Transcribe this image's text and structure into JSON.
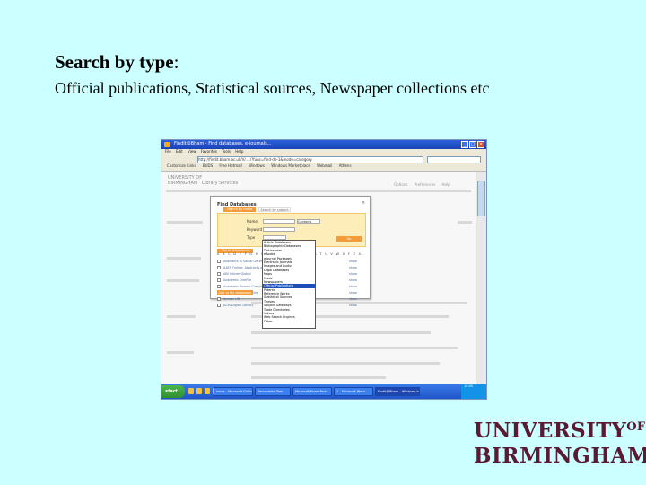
{
  "heading": {
    "bold": "Search by type",
    "rest": ":"
  },
  "subheading": "Official publications, Statistical sources, Newspaper collections etc",
  "browser": {
    "title": "FindIt@Bham - Find databases, e-journals...",
    "menu": [
      "File",
      "Edit",
      "View",
      "Favorites",
      "Tools",
      "Help"
    ],
    "address": "http://findit.bham.ac.uk/V/..../?func=find-db-1&mode=category",
    "links": [
      "Customize Links",
      "BUDS",
      "Free Hotmail",
      "Windows",
      "Windows Marketplace",
      "Webmail",
      "Athens"
    ]
  },
  "page": {
    "logo": "UNIVERSITY OF\nBIRMINGHAM   Library Services",
    "toplinks": [
      "Options",
      "Preferences",
      "Help"
    ],
    "popup": {
      "title": "Find Databases",
      "tabs": [
        "Search by name",
        "Search by subject"
      ],
      "name_label": "Name",
      "contains_value": "Contains",
      "keyword_label": "Keyword",
      "type_label": "Type",
      "go_label": "Go",
      "locate_label": "List all databases",
      "alphabet": "A B C D E F G H I J K L M N O P Q R S T U V W X Y Z 0-9",
      "results": [
        {
          "title": "Abstracts in Social Gerontology",
          "show": "show"
        },
        {
          "title": "AATA Online: Abstracts of International Conservation",
          "show": "show"
        },
        {
          "title": "ABI Inform Global",
          "show": "show"
        },
        {
          "title": "Academic OneFile",
          "show": "show"
        },
        {
          "title": "Academic Search Complete",
          "show": "show"
        },
        {
          "title": "Academic Search Elite",
          "show": "show"
        },
        {
          "title": "Access UN",
          "show": "show"
        },
        {
          "title": "ACM Digital Library",
          "show": "show"
        }
      ],
      "add_label": "Add to My databases"
    },
    "dropdown": [
      "Article Databases",
      "Bibliographic Databases",
      "Dictionaries",
      "eBooks",
      "eJournal Packages",
      "Electronic Journals",
      "Images and Audio",
      "Legal Databases",
      "Maps",
      "Music",
      "Newspapers",
      "Official Publications",
      "Patents",
      "Reference Works",
      "Statistical Sources",
      "Theses",
      "Subject Gateways",
      "Trade Directories",
      "Videos",
      "Web Search Engines",
      "Other"
    ],
    "dropdown_selected": 11
  },
  "taskbar": {
    "start": "start",
    "tasks": [
      "Inbox - Microsoft Outlook",
      "Removable Disk",
      "Microsoft PowerPoint",
      "1 - Microsoft Word",
      "FindIt@Bham - Windows Internet Explorer"
    ],
    "clock": "10:05"
  },
  "logo": {
    "line1": "UNIVERSITY",
    "of": "OF",
    "line2": "BIRMINGHAM"
  }
}
